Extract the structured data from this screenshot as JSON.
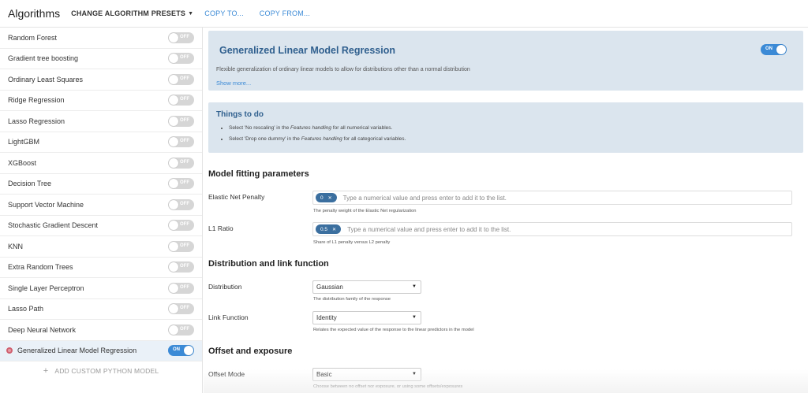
{
  "topbar": {
    "title": "Algorithms",
    "presets_label": "CHANGE ALGORITHM PRESETS",
    "copy_to": "COPY TO...",
    "copy_from": "COPY FROM..."
  },
  "sidebar": {
    "items": [
      {
        "label": "Random Forest",
        "state": "OFF"
      },
      {
        "label": "Gradient tree boosting",
        "state": "OFF"
      },
      {
        "label": "Ordinary Least Squares",
        "state": "OFF"
      },
      {
        "label": "Ridge Regression",
        "state": "OFF"
      },
      {
        "label": "Lasso Regression",
        "state": "OFF"
      },
      {
        "label": "LightGBM",
        "state": "OFF"
      },
      {
        "label": "XGBoost",
        "state": "OFF"
      },
      {
        "label": "Decision Tree",
        "state": "OFF"
      },
      {
        "label": "Support Vector Machine",
        "state": "OFF"
      },
      {
        "label": "Stochastic Gradient Descent",
        "state": "OFF"
      },
      {
        "label": "KNN",
        "state": "OFF"
      },
      {
        "label": "Extra Random Trees",
        "state": "OFF"
      },
      {
        "label": "Single Layer Perceptron",
        "state": "OFF"
      },
      {
        "label": "Lasso Path",
        "state": "OFF"
      },
      {
        "label": "Deep Neural Network",
        "state": "OFF"
      },
      {
        "label": "Generalized Linear Model Regression",
        "state": "ON"
      }
    ],
    "add_custom": "ADD CUSTOM PYTHON MODEL"
  },
  "header": {
    "title": "Generalized Linear Model Regression",
    "toggle": "ON",
    "description": "Flexible generalization of ordinary linear models to allow for distributions other than a normal distribution",
    "show_more": "Show more..."
  },
  "todo": {
    "title": "Things to do",
    "item1": {
      "pre": "Select 'No rescaling' in the ",
      "em": "Features handling",
      "post": " for all numerical variables."
    },
    "item2": {
      "pre": "Select 'Drop one dummy' in the ",
      "em": "Features handling",
      "post": " for all categorical variables."
    }
  },
  "fitting": {
    "title": "Model fitting parameters",
    "elastic": {
      "label": "Elastic Net Penalty",
      "chip": "0",
      "placeholder": "Type a numerical value and press enter to add it to the list.",
      "help": "The penalty weight of the Elastic Net regularization"
    },
    "l1": {
      "label": "L1 Ratio",
      "chip": "0.5",
      "placeholder": "Type a numerical value and press enter to add it to the list.",
      "help": "Share of L1 penalty versus L2 penalty"
    }
  },
  "distribution": {
    "title": "Distribution and link function",
    "dist": {
      "label": "Distribution",
      "value": "Gaussian",
      "help": "The distribution family of the response"
    },
    "link": {
      "label": "Link Function",
      "value": "Identity",
      "help": "Relates the expected value of the response to the linear predictors in the model"
    }
  },
  "offset": {
    "title": "Offset and exposure",
    "mode": {
      "label": "Offset Mode",
      "value": "Basic",
      "help": "Choose between no offset nor exposure, or using some offsets/exposures"
    }
  }
}
